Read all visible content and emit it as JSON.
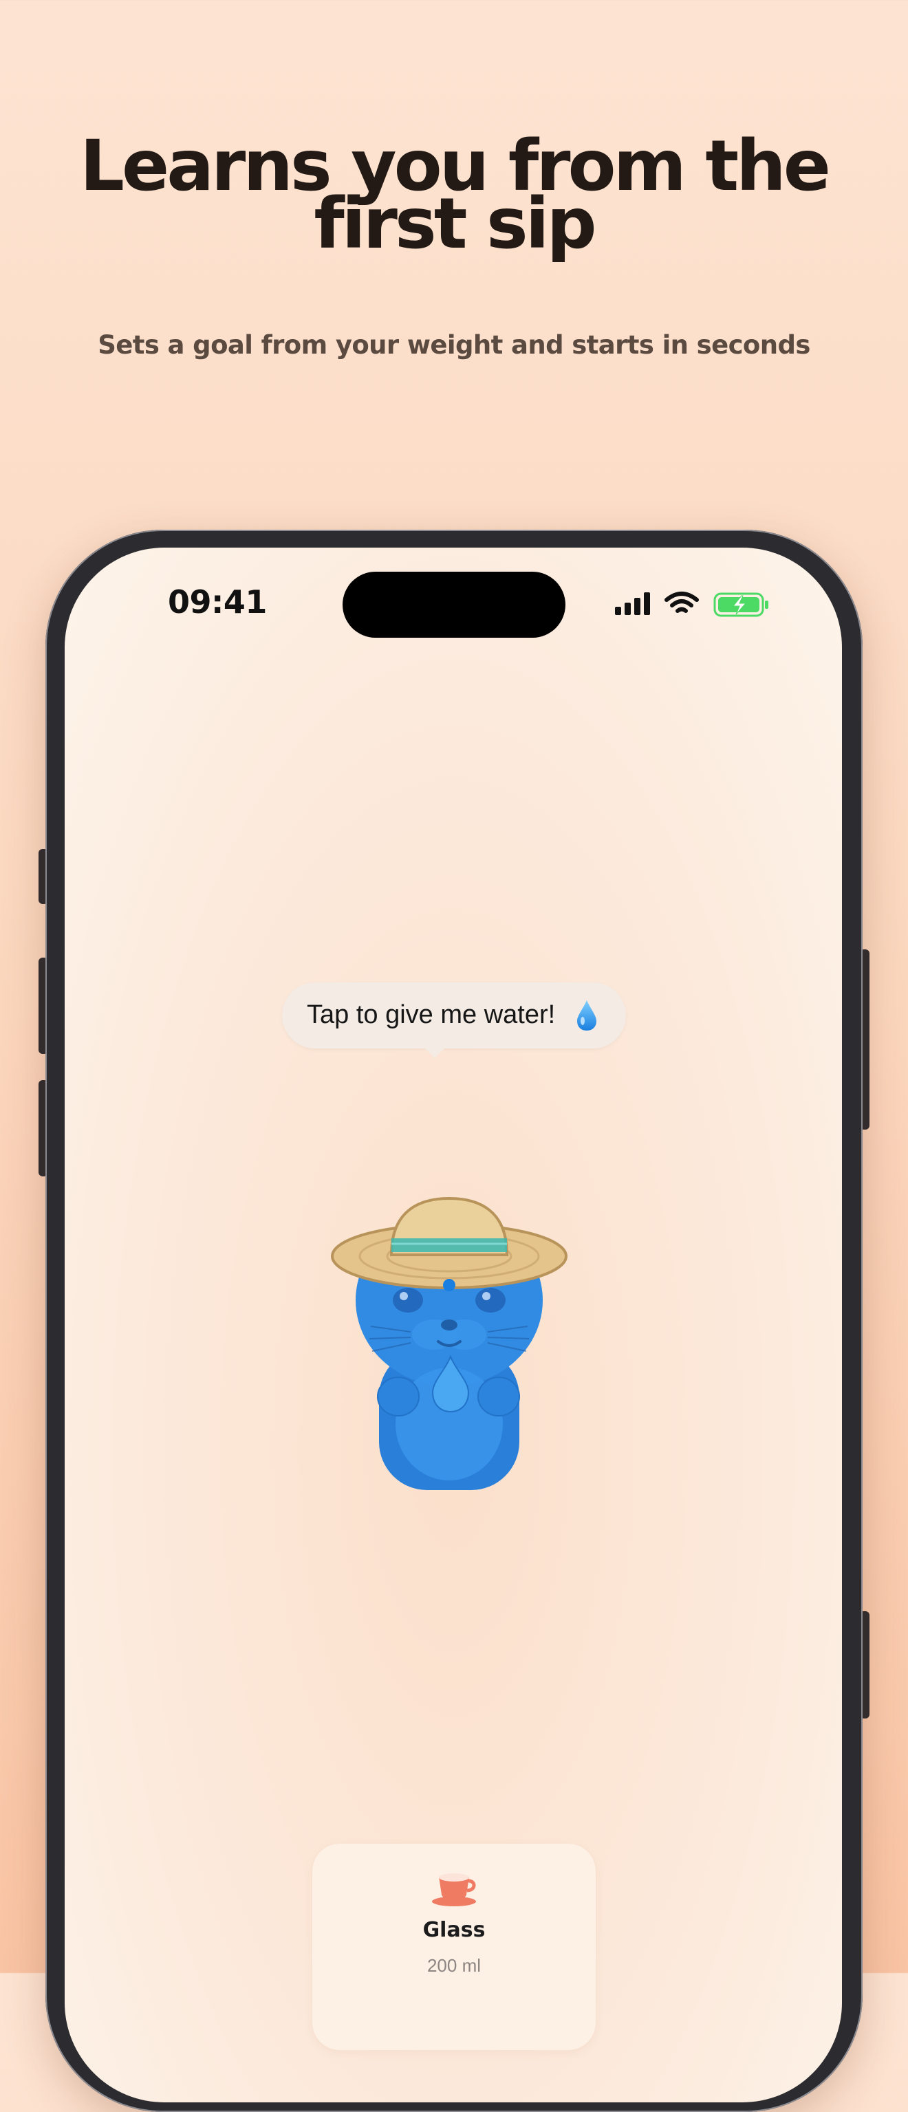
{
  "headline": {
    "line1": "Learns you from the",
    "line2": "first sip"
  },
  "subtitle": "Sets a goal from your weight and starts in seconds",
  "status_bar": {
    "time": "09:41",
    "icons": [
      "cellular-signal-icon",
      "wifi-icon",
      "battery-charging-icon"
    ]
  },
  "speech_bubble": {
    "text": "Tap to give me water!",
    "icon": "water-drop-icon"
  },
  "mascot": {
    "icon": "blue-otter-straw-hat-mascot"
  },
  "drink_card": {
    "icon": "cup-icon",
    "title": "Glass",
    "amount": "200 ml"
  },
  "colors": {
    "background_top": "#fde4d2",
    "background_bottom": "#f9c4a4",
    "headline": "#241a15",
    "mascot_blue": "#2f86e0",
    "hat_tan": "#e4c48a",
    "cup_accent": "#ef7b63",
    "battery_green": "#4cd964"
  }
}
